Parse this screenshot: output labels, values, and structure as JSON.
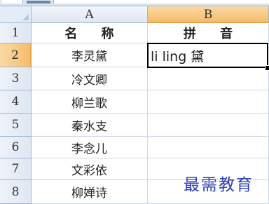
{
  "columns": [
    "A",
    "B"
  ],
  "rows": [
    "1",
    "2",
    "3",
    "4",
    "5",
    "6",
    "7",
    "8"
  ],
  "header_row": {
    "name": "名 称",
    "pinyin": "拼 音"
  },
  "names": [
    "李灵黛",
    "冷文卿",
    "柳兰歌",
    "秦水支",
    "李念儿",
    "文彩依",
    "柳婵诗"
  ],
  "active_cell": {
    "ref": "B2",
    "value": "li ling 黛"
  },
  "watermark": "最需教育",
  "colors": {
    "header_bg": "#dfe7f3",
    "active_header": "#f6bd6c",
    "grid_line": "#d0d7e5",
    "watermark": "#2b3fb4"
  }
}
